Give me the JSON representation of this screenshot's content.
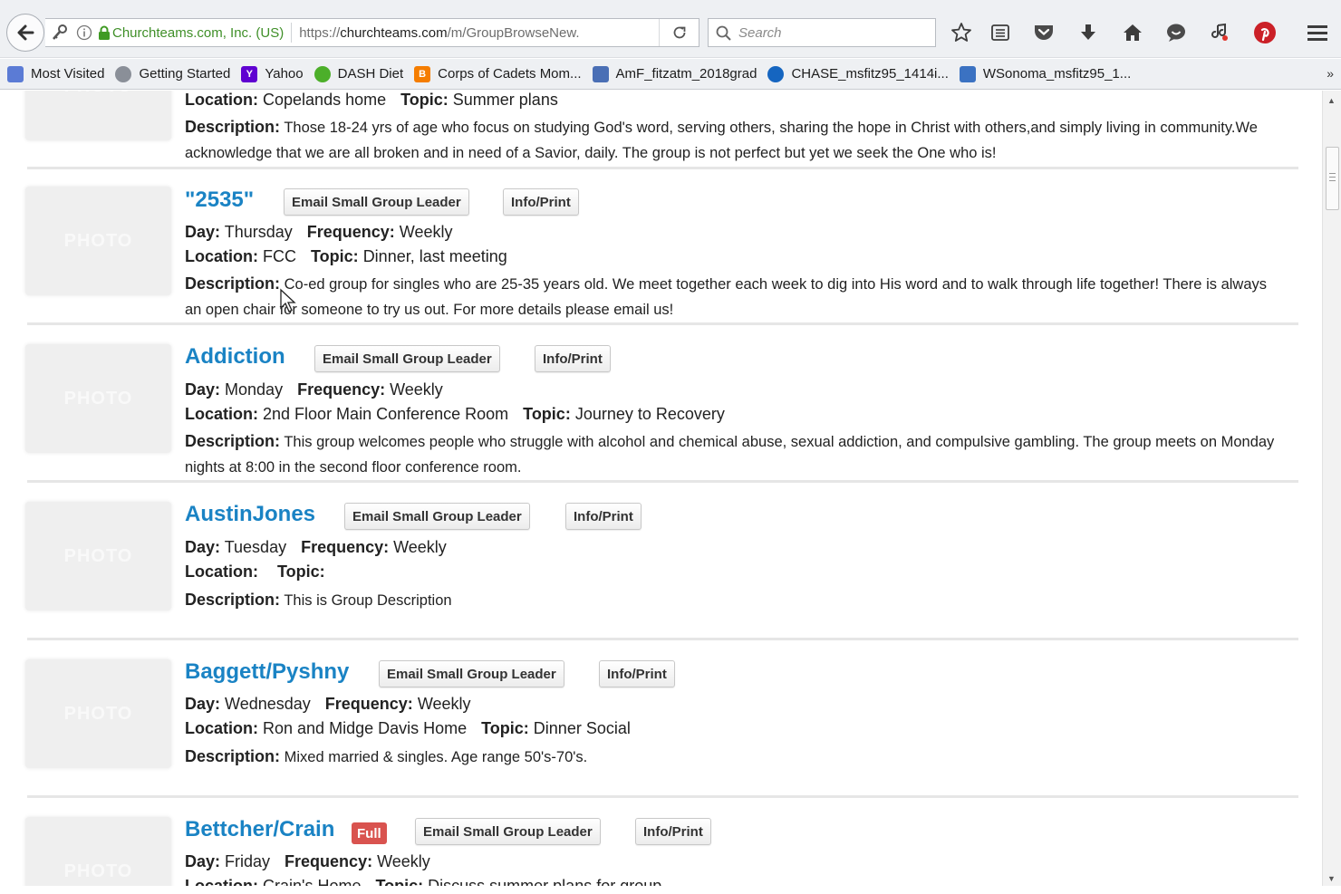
{
  "browser": {
    "identity": "Churchteams.com, Inc. (US)",
    "url_prefix": "https://",
    "url_host": "churchteams.com",
    "url_path": "/m/GroupBrowseNew.",
    "search_placeholder": "Search",
    "toolbar_icons": [
      "bookmark-star-icon",
      "reading-list-icon",
      "pocket-icon",
      "download-icon",
      "home-icon",
      "hello-chat-icon",
      "extension-icon",
      "pinterest-icon",
      "menu-icon"
    ]
  },
  "bookmarks": [
    {
      "label": "Most Visited",
      "icon": "most-visited-icon",
      "color": "#5b7bd5"
    },
    {
      "label": "Getting Started",
      "icon": "firefox-icon",
      "color": "#8a8f98"
    },
    {
      "label": "Yahoo",
      "icon": "yahoo-icon",
      "color": "#5f01d1",
      "glyph": "Y"
    },
    {
      "label": "DASH Diet",
      "icon": "apple-icon",
      "color": "#4caf2a"
    },
    {
      "label": "Corps of Cadets Mom...",
      "icon": "blogger-icon",
      "color": "#f57d00",
      "glyph": "B"
    },
    {
      "label": "AmF_fitzatm_2018grad",
      "icon": "page-icon",
      "color": "#4a6fb5"
    },
    {
      "label": "CHASE_msfitz95_1414i...",
      "icon": "chase-icon",
      "color": "#1565c0"
    },
    {
      "label": "WSonoma_msfitz95_1...",
      "icon": "ws-icon",
      "color": "#3b72c2"
    }
  ],
  "labels": {
    "day": "Day:",
    "frequency": "Frequency:",
    "location": "Location:",
    "topic": "Topic:",
    "description": "Description:",
    "email_button": "Email Small Group Leader",
    "info_button": "Info/Print",
    "photo_placeholder": "PHOTO"
  },
  "groups": [
    {
      "name": "",
      "day": "",
      "frequency": "",
      "location": "Copelands home",
      "topic": "Summer plans",
      "description": "Those 18-24 yrs of age who focus on studying God's word, serving others, sharing the hope in Christ with others,and simply living in community.We acknowledge that we are all broken and in need of a Savior, daily. The group is not perfect but yet we seek the One who is!"
    },
    {
      "name": "\"2535\"",
      "day": "Thursday",
      "frequency": "Weekly",
      "location": "FCC",
      "topic": "Dinner, last meeting",
      "description": "Co-ed group for singles who are 25-35 years old. We meet together each week to dig into His word and to walk through life together! There is always an open chair for someone to try us out. For more details please email us!"
    },
    {
      "name": "Addiction",
      "day": "Monday",
      "frequency": "Weekly",
      "location": "2nd Floor Main Conference Room",
      "topic": "Journey to Recovery",
      "description": "This group welcomes people who struggle with alcohol and chemical abuse, sexual addiction, and compulsive gambling. The group meets on Monday nights at 8:00 in the second floor conference room."
    },
    {
      "name": "AustinJones",
      "day": "Tuesday",
      "frequency": "Weekly",
      "location": "",
      "topic": "",
      "description": "This is Group Description"
    },
    {
      "name": "Baggett/Pyshny",
      "day": "Wednesday",
      "frequency": "Weekly",
      "location": "Ron and Midge Davis Home",
      "topic": "Dinner Social",
      "description": "Mixed married & singles. Age range 50's-70's."
    },
    {
      "name": "Bettcher/Crain",
      "badge": "Full",
      "day": "Friday",
      "frequency": "Weekly",
      "location": "Crain's Home",
      "topic": "Discuss summer plans for group",
      "description": ""
    }
  ]
}
